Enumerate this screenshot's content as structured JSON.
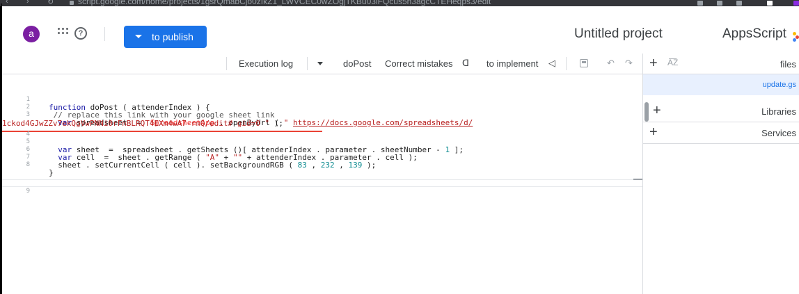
{
  "browser": {
    "url": "script.google.com/home/projects/1gsrQmabCjo0zIkZ1_LWVCEC0wZOgjTKBu03iFQcus5n3agcCTEHeqps3/edit"
  },
  "header": {
    "avatar_letter": "a",
    "publish_label": "to publish",
    "project_title": "Untitled project",
    "app_name": "AppsScript"
  },
  "toolbar": {
    "execution_log": "Execution log",
    "function_name": "doPost",
    "correct_mistakes": "Correct mistakes",
    "to_implement": "to implement"
  },
  "editor": {
    "line_numbers": [
      "1",
      "2",
      "3",
      "",
      "4",
      "5",
      "6",
      "7",
      "8",
      "9"
    ],
    "lines": [
      "function doPost ( attenderIndex ) {",
      " // replace this link with your google sheet link",
      "  var spreadsheet  =  SpreadsheetApp . openByUrl ( \" https://docs.google.com/spreadsheets/d/",
      "1ckod4GJwZZv7ekQgVwPNNi0rFnBLRQT4EXm4wA7-rmQ/edit# gid=0 \" );",
      "",
      "  var sheet  =  spreadsheet . getSheets ()[ attenderIndex . parameter . sheetNumber - 1 ];",
      "  var cell  =  sheet . getRange ( \"A\" + \"\" + attenderIndex . parameter . cell );",
      "  sheet . setCurrentCell ( cell ). setBackgroundRGB ( 83 , 232 , 139 );",
      "}",
      ""
    ]
  },
  "panel": {
    "files_label": "files",
    "file_name": "update.gs",
    "libraries_label": "Libraries",
    "services_label": "Services"
  },
  "colors": {
    "accent": "#1a73e8",
    "avatar": "#7b1fa2",
    "error_underline": "#ea4335"
  }
}
